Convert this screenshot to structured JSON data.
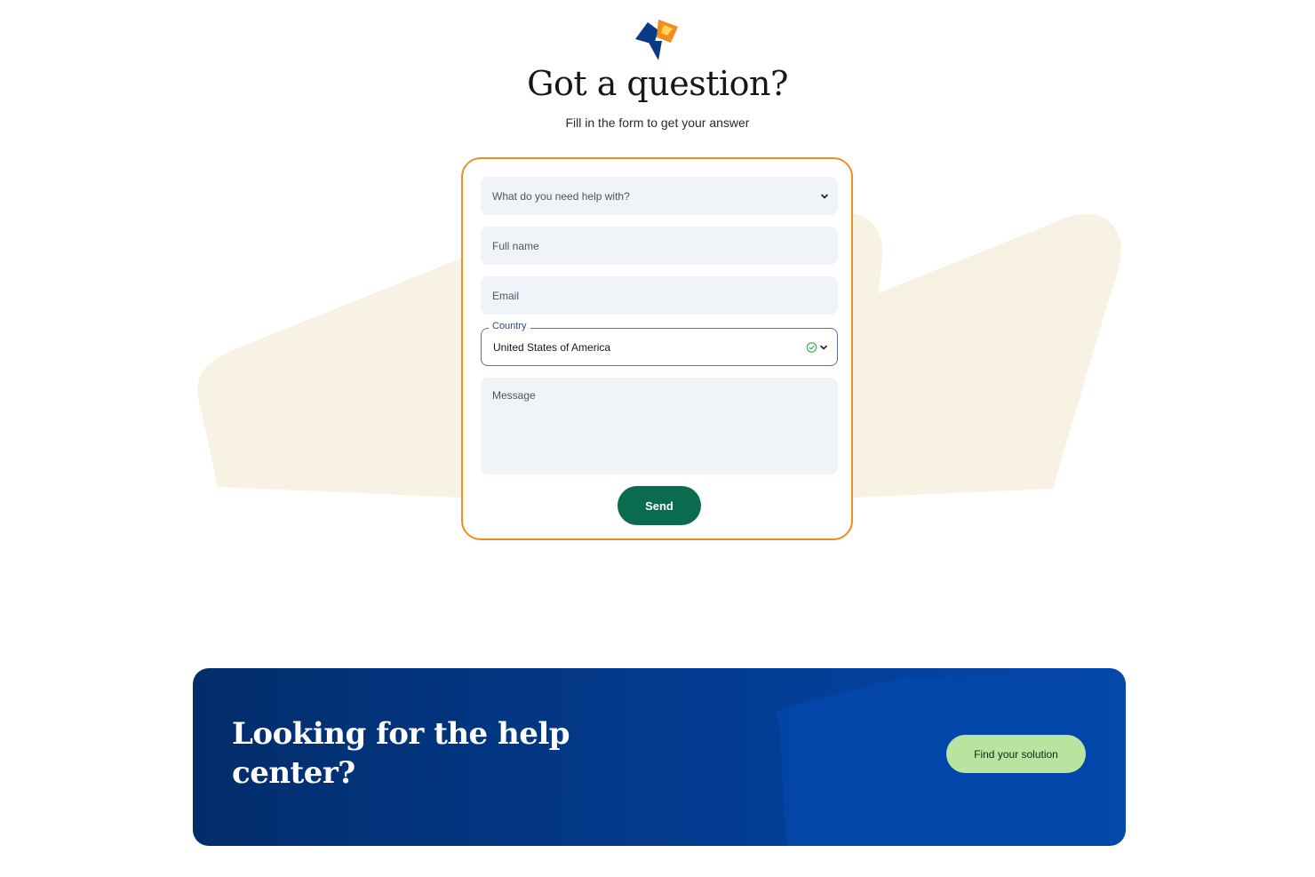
{
  "header": {
    "title": "Got a question?",
    "subtitle": "Fill in the form to get your answer"
  },
  "form": {
    "help_topic": {
      "placeholder": "What do you need help with?"
    },
    "full_name": {
      "placeholder": "Full name"
    },
    "email": {
      "placeholder": "Email"
    },
    "country": {
      "label": "Country",
      "value": "United States of America"
    },
    "message": {
      "placeholder": "Message"
    },
    "send_label": "Send"
  },
  "banner": {
    "title": "Looking for the help center?",
    "button_label": "Find your solution"
  },
  "colors": {
    "form_border": "#f28c1e",
    "send_button": "#0b6b4f",
    "banner_bg": "#03398a",
    "banner_button": "#b9e4a0",
    "field_bg": "#f0f3f7",
    "bg_shape": "#f7f2e4"
  },
  "icons": {
    "logo": "brand-logo-icon",
    "chevron": "chevron-down-icon",
    "check": "check-circle-icon"
  }
}
